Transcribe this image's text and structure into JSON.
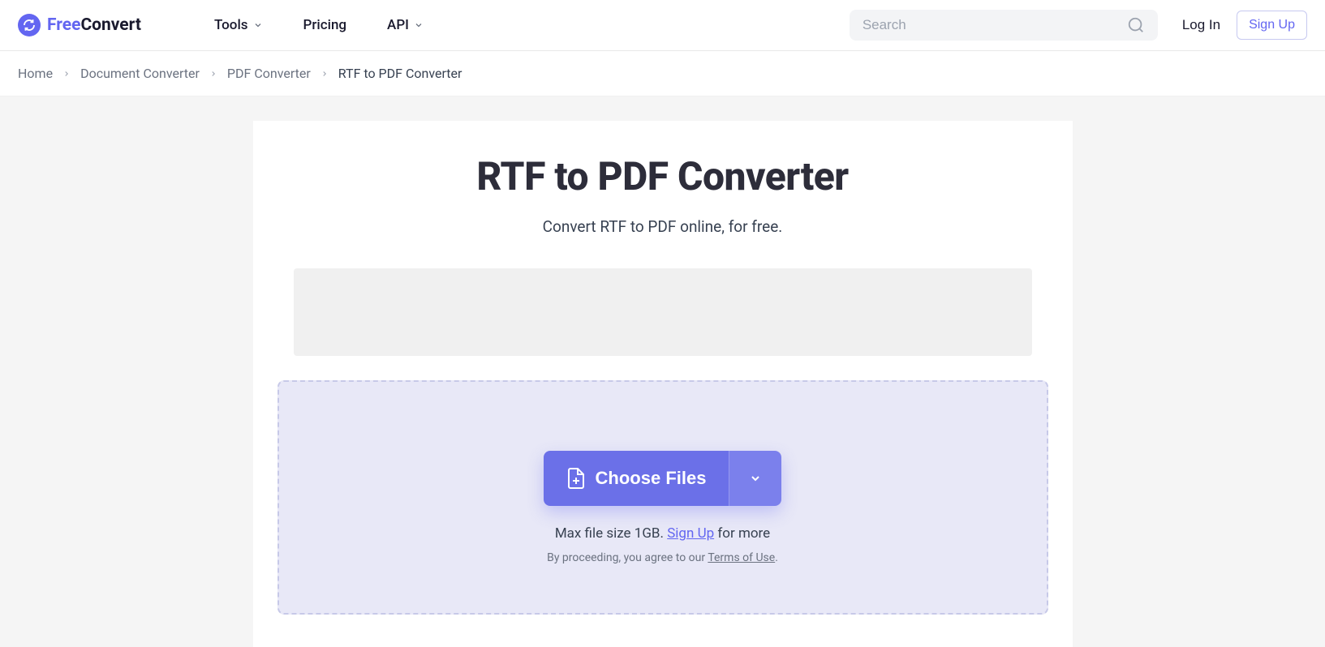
{
  "header": {
    "logo": {
      "text_free": "Free",
      "text_convert": "Convert"
    },
    "nav": {
      "tools": "Tools",
      "pricing": "Pricing",
      "api": "API"
    },
    "search": {
      "placeholder": "Search"
    },
    "auth": {
      "login": "Log In",
      "signup": "Sign Up"
    }
  },
  "breadcrumb": {
    "items": [
      {
        "label": "Home"
      },
      {
        "label": "Document Converter"
      },
      {
        "label": "PDF Converter"
      },
      {
        "label": "RTF to PDF Converter"
      }
    ]
  },
  "main": {
    "title": "RTF to PDF Converter",
    "subtitle": "Convert RTF to PDF online, for free.",
    "choose_files": "Choose Files",
    "max_file_prefix": "Max file size 1GB. ",
    "signup_link": "Sign Up",
    "max_file_suffix": " for more",
    "terms_prefix": "By proceeding, you agree to our ",
    "terms_link": "Terms of Use",
    "terms_suffix": "."
  }
}
